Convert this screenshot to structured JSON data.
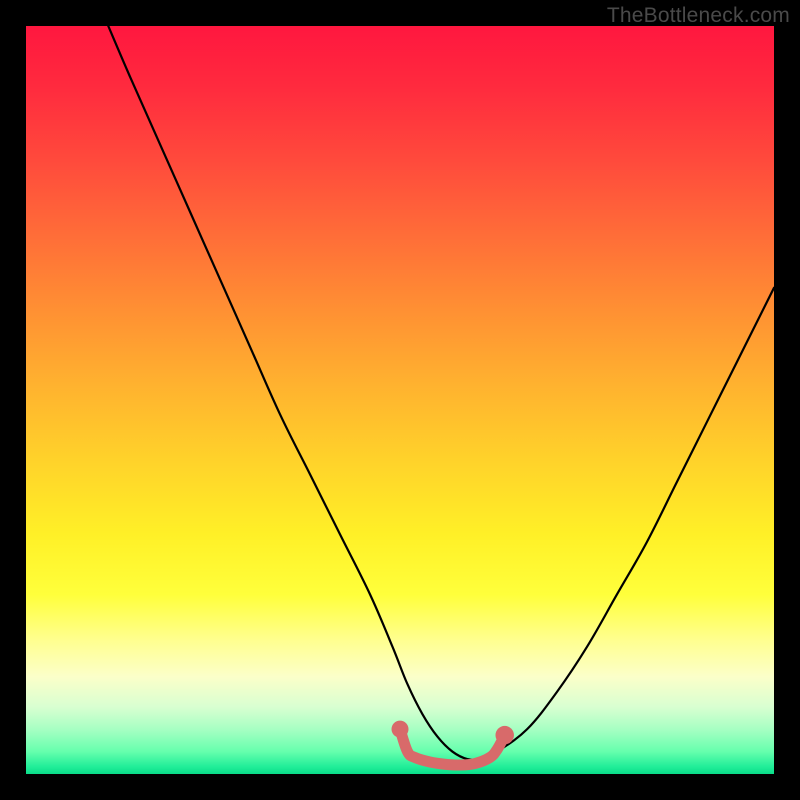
{
  "watermark": "TheBottleneck.com",
  "chart_data": {
    "type": "line",
    "title": "",
    "xlabel": "",
    "ylabel": "",
    "xlim": [
      0,
      100
    ],
    "ylim": [
      0,
      100
    ],
    "series": [
      {
        "name": "bottleneck-curve",
        "color": "#000000",
        "x": [
          11,
          14,
          18,
          22,
          26,
          30,
          34,
          38,
          42,
          46,
          49,
          51,
          53,
          55,
          57,
          59,
          61,
          63,
          67,
          71,
          75,
          79,
          83,
          87,
          91,
          95,
          99,
          100
        ],
        "values": [
          100,
          93,
          84,
          75,
          66,
          57,
          48,
          40,
          32,
          24,
          17,
          12,
          8,
          5,
          3,
          2,
          2,
          3,
          6,
          11,
          17,
          24,
          31,
          39,
          47,
          55,
          63,
          65
        ]
      },
      {
        "name": "highlight-band",
        "color": "#d86a6a",
        "x": [
          50,
          51,
          52,
          54,
          56,
          58,
          60,
          62,
          63,
          64
        ],
        "values": [
          6,
          3,
          2.2,
          1.6,
          1.3,
          1.2,
          1.4,
          2.2,
          3.3,
          5.2
        ]
      }
    ],
    "markers": [
      {
        "name": "left-dot",
        "x": 50,
        "y": 6,
        "r": 1.2,
        "color": "#d86a6a"
      },
      {
        "name": "right-dot",
        "x": 64,
        "y": 5.2,
        "r": 1.4,
        "color": "#d86a6a"
      }
    ]
  }
}
